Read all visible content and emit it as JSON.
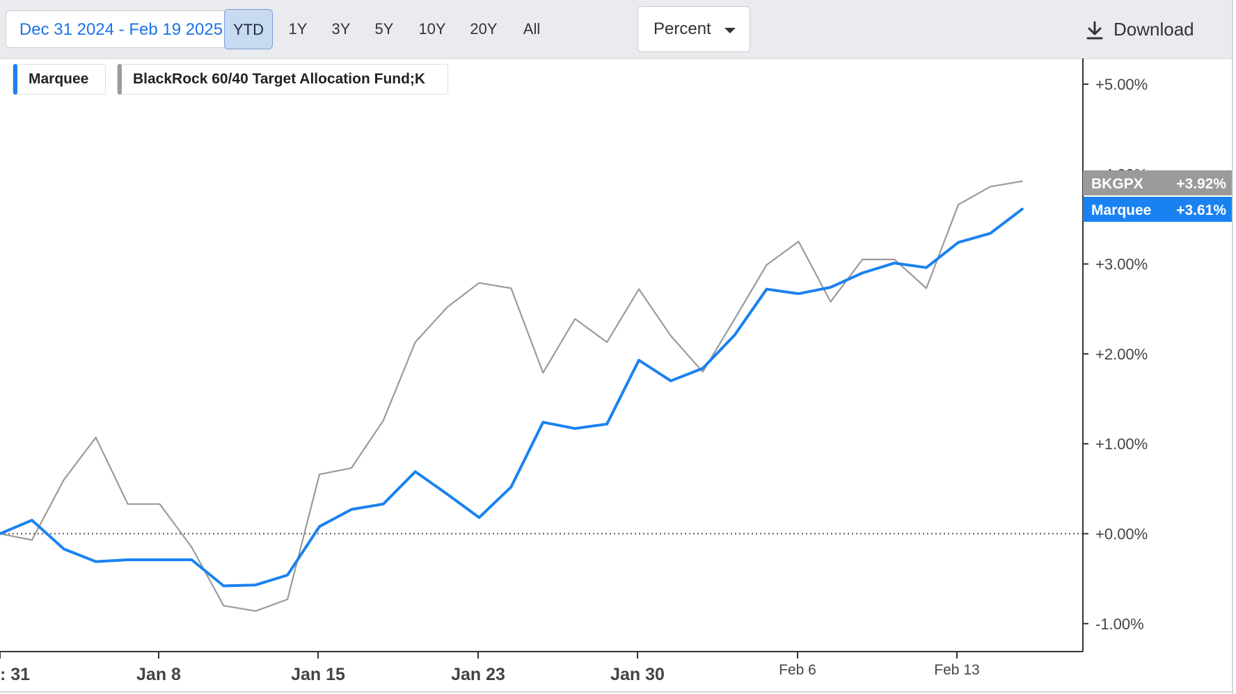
{
  "toolbar": {
    "date_range": "Dec 31 2024 - Feb 19 2025",
    "ranges": [
      "YTD",
      "1Y",
      "3Y",
      "5Y",
      "10Y",
      "20Y",
      "All"
    ],
    "active_range": "YTD",
    "mode": "Percent",
    "download_label": "Download",
    "download_icon": "download-icon"
  },
  "legend": [
    {
      "label": "Marquee",
      "color": "#1a82f0"
    },
    {
      "label": "BlackRock 60/40 Target Allocation Fund;K",
      "color": "#9a9a9a"
    }
  ],
  "chart_data": {
    "type": "line",
    "x_tick_labels": [
      ": 31",
      "Jan 8",
      "Jan 15",
      "Jan 23",
      "Jan 30",
      "Feb 6",
      "Feb 13"
    ],
    "y_tick_labels": [
      "+5.00%",
      "+4.00%",
      "+3.00%",
      "+2.00%",
      "+1.00%",
      "+0.00%",
      "-1.00%"
    ],
    "ylim": [
      -1.3,
      5.2
    ],
    "baseline": 0,
    "series": [
      {
        "name": "Marquee",
        "color": "#1a82f0",
        "values": [
          0.0,
          0.15,
          -0.17,
          -0.31,
          -0.29,
          -0.29,
          -0.29,
          -0.58,
          -0.57,
          -0.46,
          0.08,
          0.27,
          0.33,
          0.69,
          0.44,
          0.18,
          0.52,
          1.24,
          1.17,
          1.22,
          1.93,
          1.7,
          1.84,
          2.21,
          2.72,
          2.67,
          2.74,
          2.9,
          3.01,
          2.96,
          3.24,
          3.34,
          3.61
        ],
        "end_badge": {
          "label": "Marquee",
          "value": "+3.61%"
        }
      },
      {
        "name": "BKGPX",
        "color": "#9a9a9a",
        "values": [
          0.0,
          -0.07,
          0.6,
          1.07,
          0.33,
          0.33,
          -0.15,
          -0.8,
          -0.86,
          -0.73,
          0.66,
          0.73,
          1.26,
          2.13,
          2.52,
          2.79,
          2.73,
          1.79,
          2.39,
          2.13,
          2.72,
          2.2,
          1.8,
          2.39,
          2.99,
          3.25,
          2.58,
          3.05,
          3.05,
          2.73,
          3.66,
          3.86,
          3.92
        ],
        "end_badge": {
          "label": "BKGPX",
          "value": "+3.92%"
        }
      }
    ]
  }
}
